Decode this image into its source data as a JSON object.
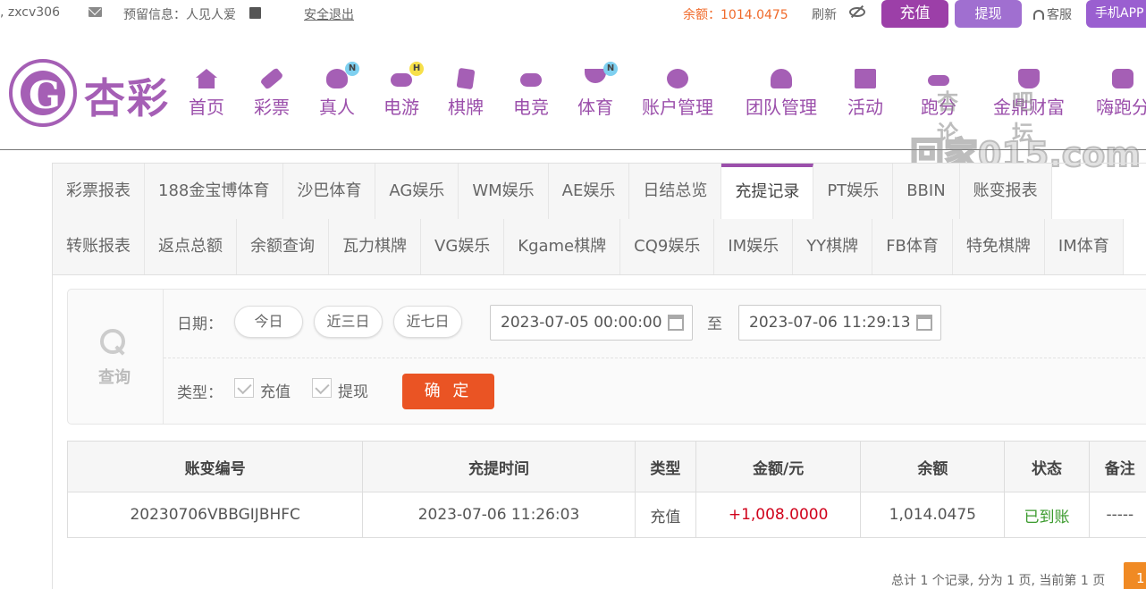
{
  "topbar": {
    "user": ", zxcv306",
    "reserve_info": "预留信息：人见人爱",
    "logout": "安全退出",
    "balance": "余额：1014.0475",
    "refresh": "刷新",
    "deposit": "充值",
    "withdraw": "提现",
    "customer_service": "客服",
    "mobile_app": "手机APP"
  },
  "brand": {
    "logo_text": "杏彩",
    "color": "#a55fb5"
  },
  "nav": {
    "items": [
      {
        "label": "首页",
        "icon": "home-icon"
      },
      {
        "label": "彩票",
        "icon": "ticket-icon"
      },
      {
        "label": "真人",
        "icon": "dealer-icon",
        "badge": "N"
      },
      {
        "label": "电游",
        "icon": "gamepad-icon",
        "badge": "H"
      },
      {
        "label": "棋牌",
        "icon": "cards-icon"
      },
      {
        "label": "电竞",
        "icon": "esports-icon"
      },
      {
        "label": "体育",
        "icon": "trophy-icon",
        "badge": "N"
      },
      {
        "label": "账户管理",
        "icon": "yuan-coin-icon"
      },
      {
        "label": "团队管理",
        "icon": "team-icon"
      },
      {
        "label": "活动",
        "icon": "gift-icon"
      },
      {
        "label": "跑分",
        "icon": "car-icon"
      },
      {
        "label": "金鼎财富",
        "icon": "tripod-icon"
      },
      {
        "label": "嗨跑分",
        "icon": "hi-app-icon"
      }
    ]
  },
  "watermark": {
    "top": "杏吧论坛",
    "bottom": "回家015.com"
  },
  "tabs": {
    "row1": [
      "彩票报表",
      "188金宝博体育",
      "沙巴体育",
      "AG娱乐",
      "WM娱乐",
      "AE娱乐",
      "日结总览",
      "充提记录",
      "PT娱乐",
      "BBIN",
      "账变报表"
    ],
    "row2": [
      "转账报表",
      "返点总额",
      "余额查询",
      "瓦力棋牌",
      "VG娱乐",
      "Kgame棋牌",
      "CQ9娱乐",
      "IM娱乐",
      "YY棋牌",
      "FB体育",
      "特免棋牌",
      "IM体育"
    ],
    "active": "充提记录"
  },
  "query": {
    "title": "查询",
    "date_label": "日期：",
    "quick": [
      "今日",
      "近三日",
      "近七日"
    ],
    "start": "2023-07-05 00:00:00",
    "to": "至",
    "end": "2023-07-06 11:29:13",
    "type_label": "类型：",
    "type_deposit": "充值",
    "type_withdraw": "提现",
    "confirm": "确 定"
  },
  "table": {
    "headers": [
      "账变编号",
      "充提时间",
      "类型",
      "金额/元",
      "余额",
      "状态",
      "备注"
    ],
    "rows": [
      {
        "id": "20230706VBBGIJBHFC",
        "time": "2023-07-06 11:26:03",
        "type": "充值",
        "amount": "+1,008.0000",
        "balance": "1,014.0475",
        "status": "已到账",
        "note": "-----"
      }
    ]
  },
  "pagination": {
    "summary": "总计 1 个记录, 分为 1 页, 当前第 1 页",
    "current": "1"
  }
}
